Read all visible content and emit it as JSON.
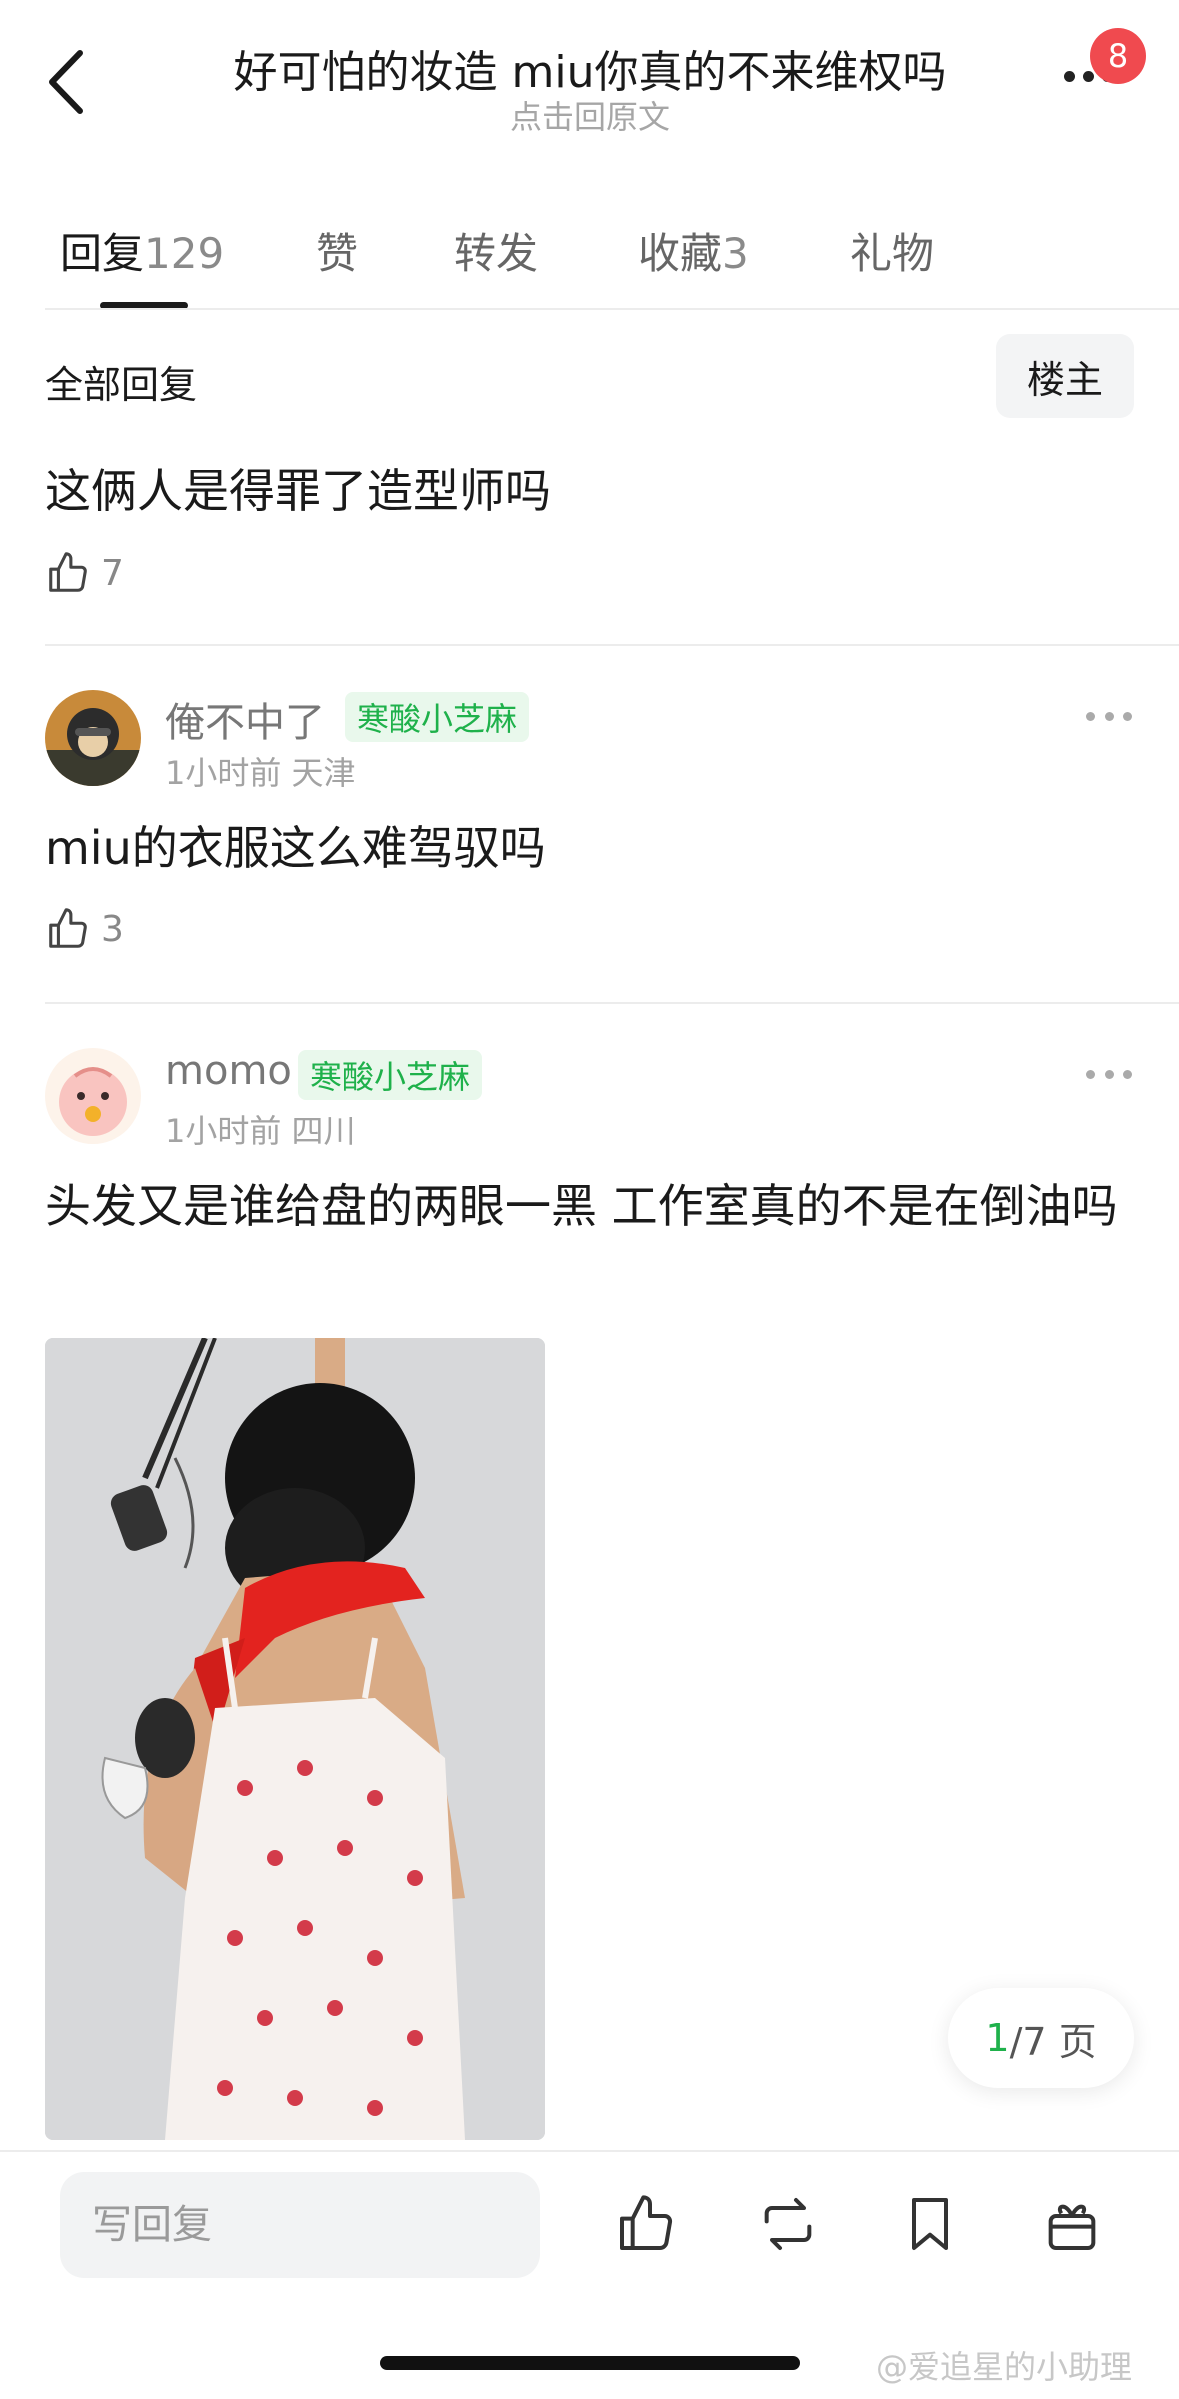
{
  "header": {
    "title": "好可怕的妆造 miu你真的不来维权吗",
    "subtitle": "点击回原文",
    "notification_count": "8"
  },
  "tabs": [
    {
      "label": "回复",
      "count": "129",
      "active": true
    },
    {
      "label": "赞",
      "count": "",
      "active": false
    },
    {
      "label": "转发",
      "count": "",
      "active": false
    },
    {
      "label": "收藏",
      "count": "3",
      "active": false
    },
    {
      "label": "礼物",
      "count": "",
      "active": false
    }
  ],
  "section": {
    "title": "全部回复",
    "op_filter_label": "楼主"
  },
  "comments": [
    {
      "text": "这俩人是得罪了造型师吗",
      "likes": "7"
    },
    {
      "username": "俺不中了",
      "level": "寒酸小芝麻",
      "time": "1小时前",
      "location": "天津",
      "text": "miu的衣服这么难驾驭吗",
      "likes": "3"
    },
    {
      "username": "momo",
      "level": "寒酸小芝麻",
      "time": "1小时前",
      "location": "四川",
      "text": "头发又是谁给盘的两眼一黑 工作室真的不是在倒油吗",
      "has_image": true
    }
  ],
  "pager": {
    "current": "1",
    "total_text": "/7 页"
  },
  "bottom_bar": {
    "reply_placeholder": "写回复",
    "icons": [
      "like-icon",
      "repost-icon",
      "bookmark-icon",
      "gift-icon"
    ]
  },
  "watermark": "@爱追星的小助理",
  "colors": {
    "accent_green": "#1fb14b",
    "badge_red": "#f04a4f",
    "level_tag_bg": "#e9f8ec"
  }
}
